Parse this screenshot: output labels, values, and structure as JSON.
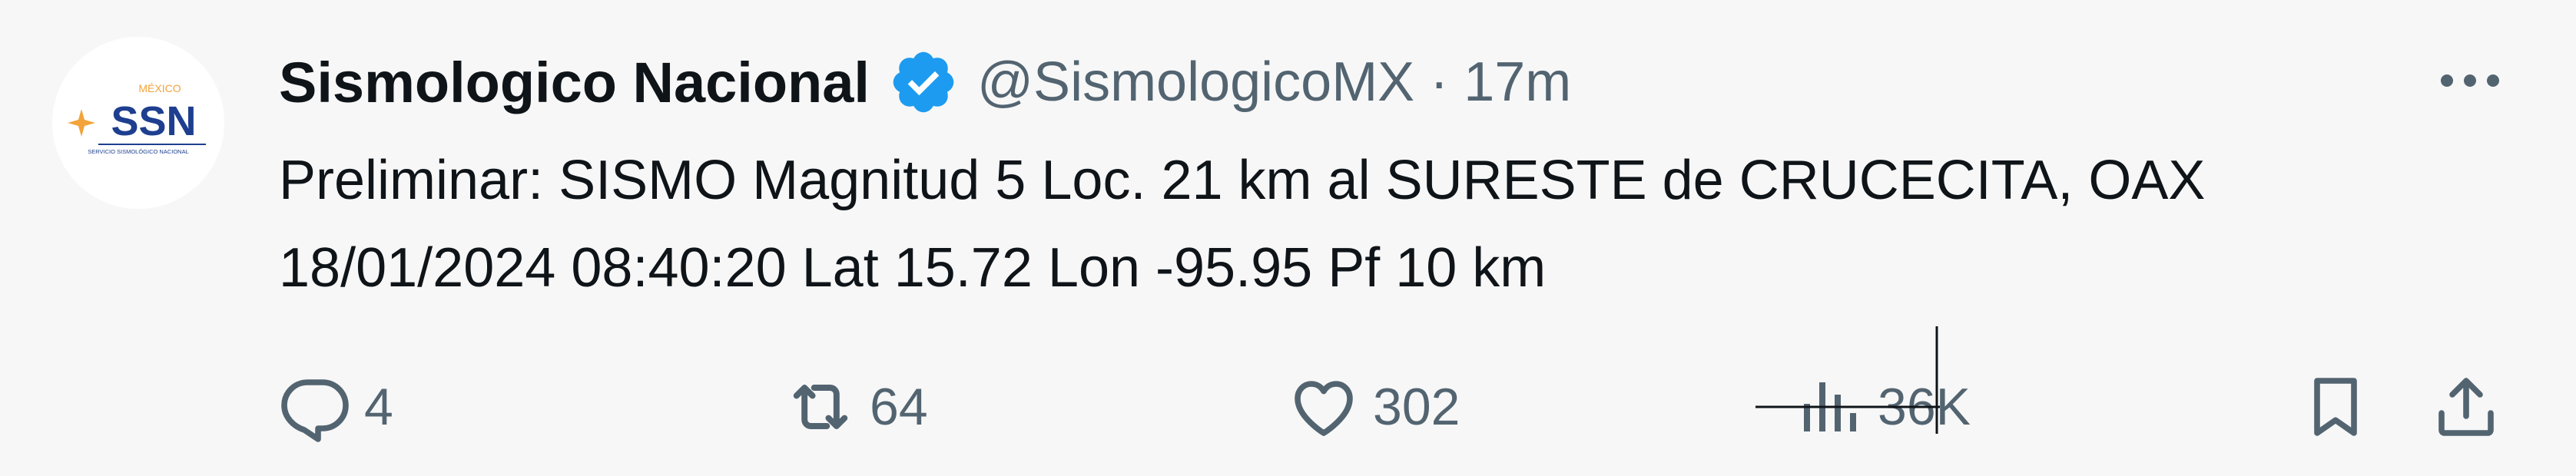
{
  "account": {
    "display_name": "Sismologico Nacional",
    "handle": "@SismologicoMX",
    "separator": "·",
    "time": "17m",
    "verified": true,
    "avatar": {
      "logo_text": "SSN",
      "logo_top_text": "MÉXICO",
      "logo_bottom_text": "SERVICIO SISMOLÓGICO NACIONAL"
    }
  },
  "tweet": {
    "text": "Preliminar: SISMO Magnitud 5 Loc. 21 km al SURESTE de CRUCECITA, OAX\n18/01/2024 08:40:20 Lat 15.72 Lon -95.95 Pf 10 km"
  },
  "actions": {
    "replies": "4",
    "retweets": "64",
    "likes": "302",
    "views": "36K"
  },
  "colors": {
    "background": "#f7f7f7",
    "text_primary": "#0f1419",
    "text_secondary": "#536471",
    "verified_blue": "#1d9bf0",
    "logo_blue": "#1e3f8f",
    "logo_orange": "#f2a33a"
  },
  "icons": {
    "more": "more-horizontal-icon",
    "verified": "verified-badge-icon",
    "reply": "reply-icon",
    "retweet": "retweet-icon",
    "like": "heart-icon",
    "views": "views-chart-icon",
    "bookmark": "bookmark-icon",
    "share": "share-icon",
    "cursor": "text-cursor-icon"
  }
}
